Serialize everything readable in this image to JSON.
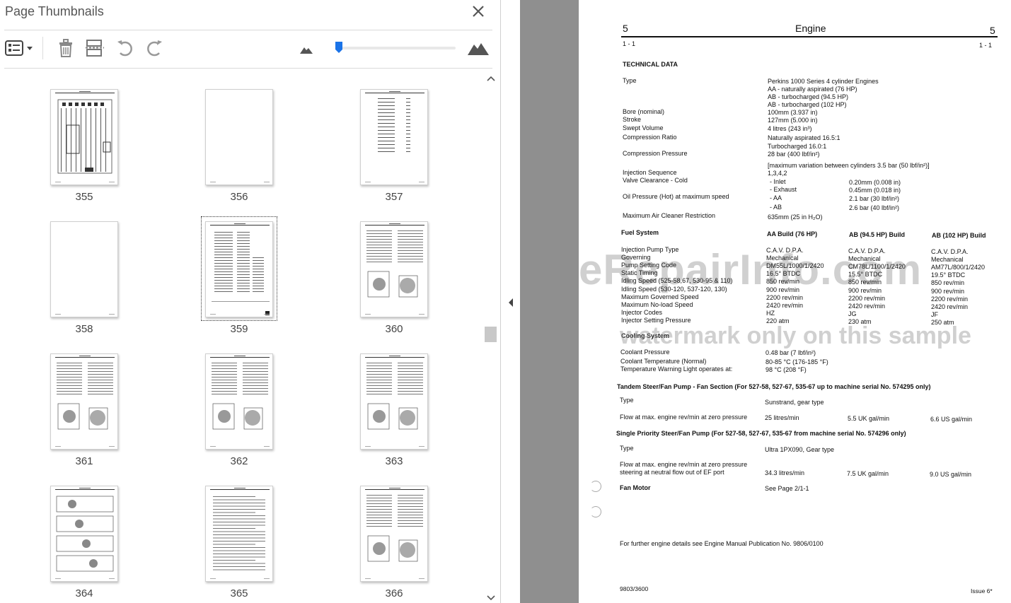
{
  "panel": {
    "title": "Page Thumbnails",
    "icons": [
      "page-list-options-icon",
      "delete-icon",
      "extract-page-icon",
      "undo-icon",
      "redo-icon",
      "zoom-out-mountain-icon",
      "zoom-in-mountain-icon",
      "close-icon"
    ],
    "zoom_fraction": 0.02
  },
  "thumbnails": [
    {
      "label": "355"
    },
    {
      "label": "356"
    },
    {
      "label": "357"
    },
    {
      "label": "358"
    },
    {
      "label": "359"
    },
    {
      "label": "360"
    },
    {
      "label": "361"
    },
    {
      "label": "362"
    },
    {
      "label": "363"
    },
    {
      "label": "364"
    },
    {
      "label": "365"
    },
    {
      "label": "366"
    }
  ],
  "selected_thumbnail": "359",
  "doc": {
    "section_num": "5",
    "section_title": "Engine",
    "page_ref": "1 - 1",
    "heading": "TECHNICAL DATA",
    "type_label": "Type",
    "type_values": [
      "Perkins 1000 Series 4 cylinder Engines",
      "AA - naturally aspirated (76 HP)",
      "AB - turbocharged (94.5 HP)",
      "AB - turbocharged (102 HP)"
    ],
    "rows": [
      {
        "label": "Bore (nominal)",
        "value": "100mm (3.937 in)"
      },
      {
        "label": "Stroke",
        "value": "127mm (5.000 in)"
      },
      {
        "label": "Swept Volume",
        "value": "4 litres (243 in³)"
      },
      {
        "label": "Compression Ratio",
        "value": "Naturally aspirated 16.5:1"
      },
      {
        "label": "",
        "value": "Turbocharged 16.0:1"
      },
      {
        "label": "Compression Pressure",
        "value": "28 bar (400 lbf/in²)"
      },
      {
        "label": "",
        "value": "[maximum variation between cylinders 3.5 bar (50 lbf/in²)]"
      },
      {
        "label": "Injection Sequence",
        "value": "1,3,4,2"
      },
      {
        "label": "Valve Clearance - Cold",
        "value": ""
      }
    ],
    "valve": [
      {
        "k": "- Inlet",
        "v": "0.20mm (0.008 in)"
      },
      {
        "k": "- Exhaust",
        "v": "0.45mm (0.018 in)"
      },
      {
        "k": "- AA",
        "v": "2.1 bar (30 lbf/in²)"
      },
      {
        "k": "- AB",
        "v": "2.6 bar (40 lbf/in²)"
      }
    ],
    "oil_label": "Oil Pressure (Hot) at maximum speed",
    "air_label": "Maximum Air Cleaner Restriction",
    "air_value": "635mm (25 in H₂O)",
    "fuel_heading": "Fuel System",
    "fuel_cols": [
      "AA Build (76 HP)",
      "AB (94.5 HP) Build",
      "AB (102 HP) Build"
    ],
    "fuel_rows": [
      {
        "label": "Injection Pump Type",
        "v": [
          "C.A.V. D.P.A.",
          "C.A.V. D.P.A.",
          "C.A.V. D.P.A."
        ]
      },
      {
        "label": "Governing",
        "v": [
          "Mechanical",
          "Mechanical",
          "Mechanical"
        ]
      },
      {
        "label": "Pump Setting Code",
        "v": [
          "DM55L/1000/1/2420",
          "CM78L/1100/1/2420",
          "AM77L/800/1/2420"
        ]
      },
      {
        "label": "Static Timing",
        "v": [
          "16.5° BTDC",
          "15.5° BTDC",
          "19.5° BTDC"
        ]
      },
      {
        "label": "Idling Speed (525-58,67, 530-95 & 110)",
        "v": [
          "850 rev/min",
          "850 rev/min",
          "850 rev/min"
        ]
      },
      {
        "label": "Idling Speed (530-120, 537-120, 130)",
        "v": [
          "900 rev/min",
          "900 rev/min",
          "900 rev/min"
        ]
      },
      {
        "label": "Maximum Governed Speed",
        "v": [
          "2200 rev/min",
          "2200 rev/min",
          "2200 rev/min"
        ]
      },
      {
        "label": "Maximum No-load Speed",
        "v": [
          "2420 rev/min",
          "2420 rev/min",
          "2420 rev/min"
        ]
      },
      {
        "label": "Injector Codes",
        "v": [
          "HZ",
          "JG",
          "JF"
        ]
      },
      {
        "label": "Injector Setting Pressure",
        "v": [
          "220 atm",
          "230 atm",
          "250 atm"
        ]
      }
    ],
    "cooling_heading": "Cooling System",
    "cooling_rows": [
      {
        "label": "Coolant Pressure",
        "value": "0.48 bar (7 lbf/in²)"
      },
      {
        "label": "Coolant Temperature (Normal)",
        "value": "80-85 °C (176-185 °F)"
      },
      {
        "label": "Temperature Warning Light operates at:",
        "value": "98 °C (208 °F)"
      }
    ],
    "tandem_heading": "Tandem Steer/Fan Pump - Fan Section (For 527-58, 527-67, 535-67 up to machine serial No. 574295 only)",
    "tandem_type_label": "Type",
    "tandem_type_value": "Sunstrand, gear type",
    "tandem_flow_label": "Flow at max. engine rev/min at zero pressure",
    "tandem_flow": [
      "25 litres/min",
      "5.5 UK gal/min",
      "6.6 US gal/min"
    ],
    "single_heading": "Single Priority Steer/Fan Pump (For 527-58, 527-67, 535-67 from machine serial No. 574296 only)",
    "single_type_label": "Type",
    "single_type_value": "Ultra 1PX090, Gear type",
    "single_flow_label_1": "Flow at max. engine rev/min at zero pressure",
    "single_flow_label_2": "steering at neutral flow out of EF port",
    "single_flow": [
      "34.3 litres/min",
      "7.5 UK gal/min",
      "9.0 US gal/min"
    ],
    "fan_label": "Fan Motor",
    "fan_value": "See Page 2/1-1",
    "further": "For further engine details see Engine Manual Publication No. 9806/0100",
    "footer_left": "9803/3600",
    "footer_right": "Issue 6*",
    "watermark_1": "eRepairInfo.com",
    "watermark_2": "watermark only on this sample"
  }
}
